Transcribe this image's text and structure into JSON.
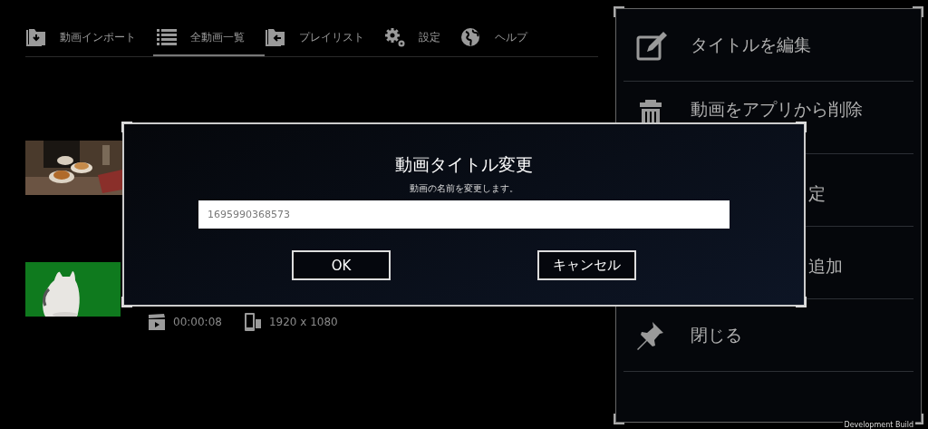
{
  "nav": [
    {
      "label": "動画インポート",
      "selected": false
    },
    {
      "label": "全動画一覧",
      "selected": true
    },
    {
      "label": "プレイリスト",
      "selected": false
    },
    {
      "label": "設定",
      "selected": false
    },
    {
      "label": "ヘルプ",
      "selected": false
    }
  ],
  "videos": [
    {
      "thumbnail": {
        "kind": "picture"
      }
    },
    {
      "thumbnail": {
        "kind": "picture"
      },
      "duration": "00:00:08",
      "resolution": "1920 x 1080"
    }
  ],
  "menu": {
    "items": [
      {
        "label": "タイトルを編集",
        "kind": "full"
      },
      {
        "label": "動画をアプリから削除",
        "kind": "full"
      },
      {
        "label": "定",
        "kind": "partial"
      },
      {
        "label": "追加",
        "kind": "partial"
      },
      {
        "label": "閉じる",
        "kind": "full"
      }
    ]
  },
  "dialog": {
    "title": "動画タイトル変更",
    "subtitle": "動画の名前を変更します。",
    "value": "1695990368573",
    "buttons": [
      "OK",
      "キャンセル"
    ]
  },
  "build_label": "Development Build"
}
